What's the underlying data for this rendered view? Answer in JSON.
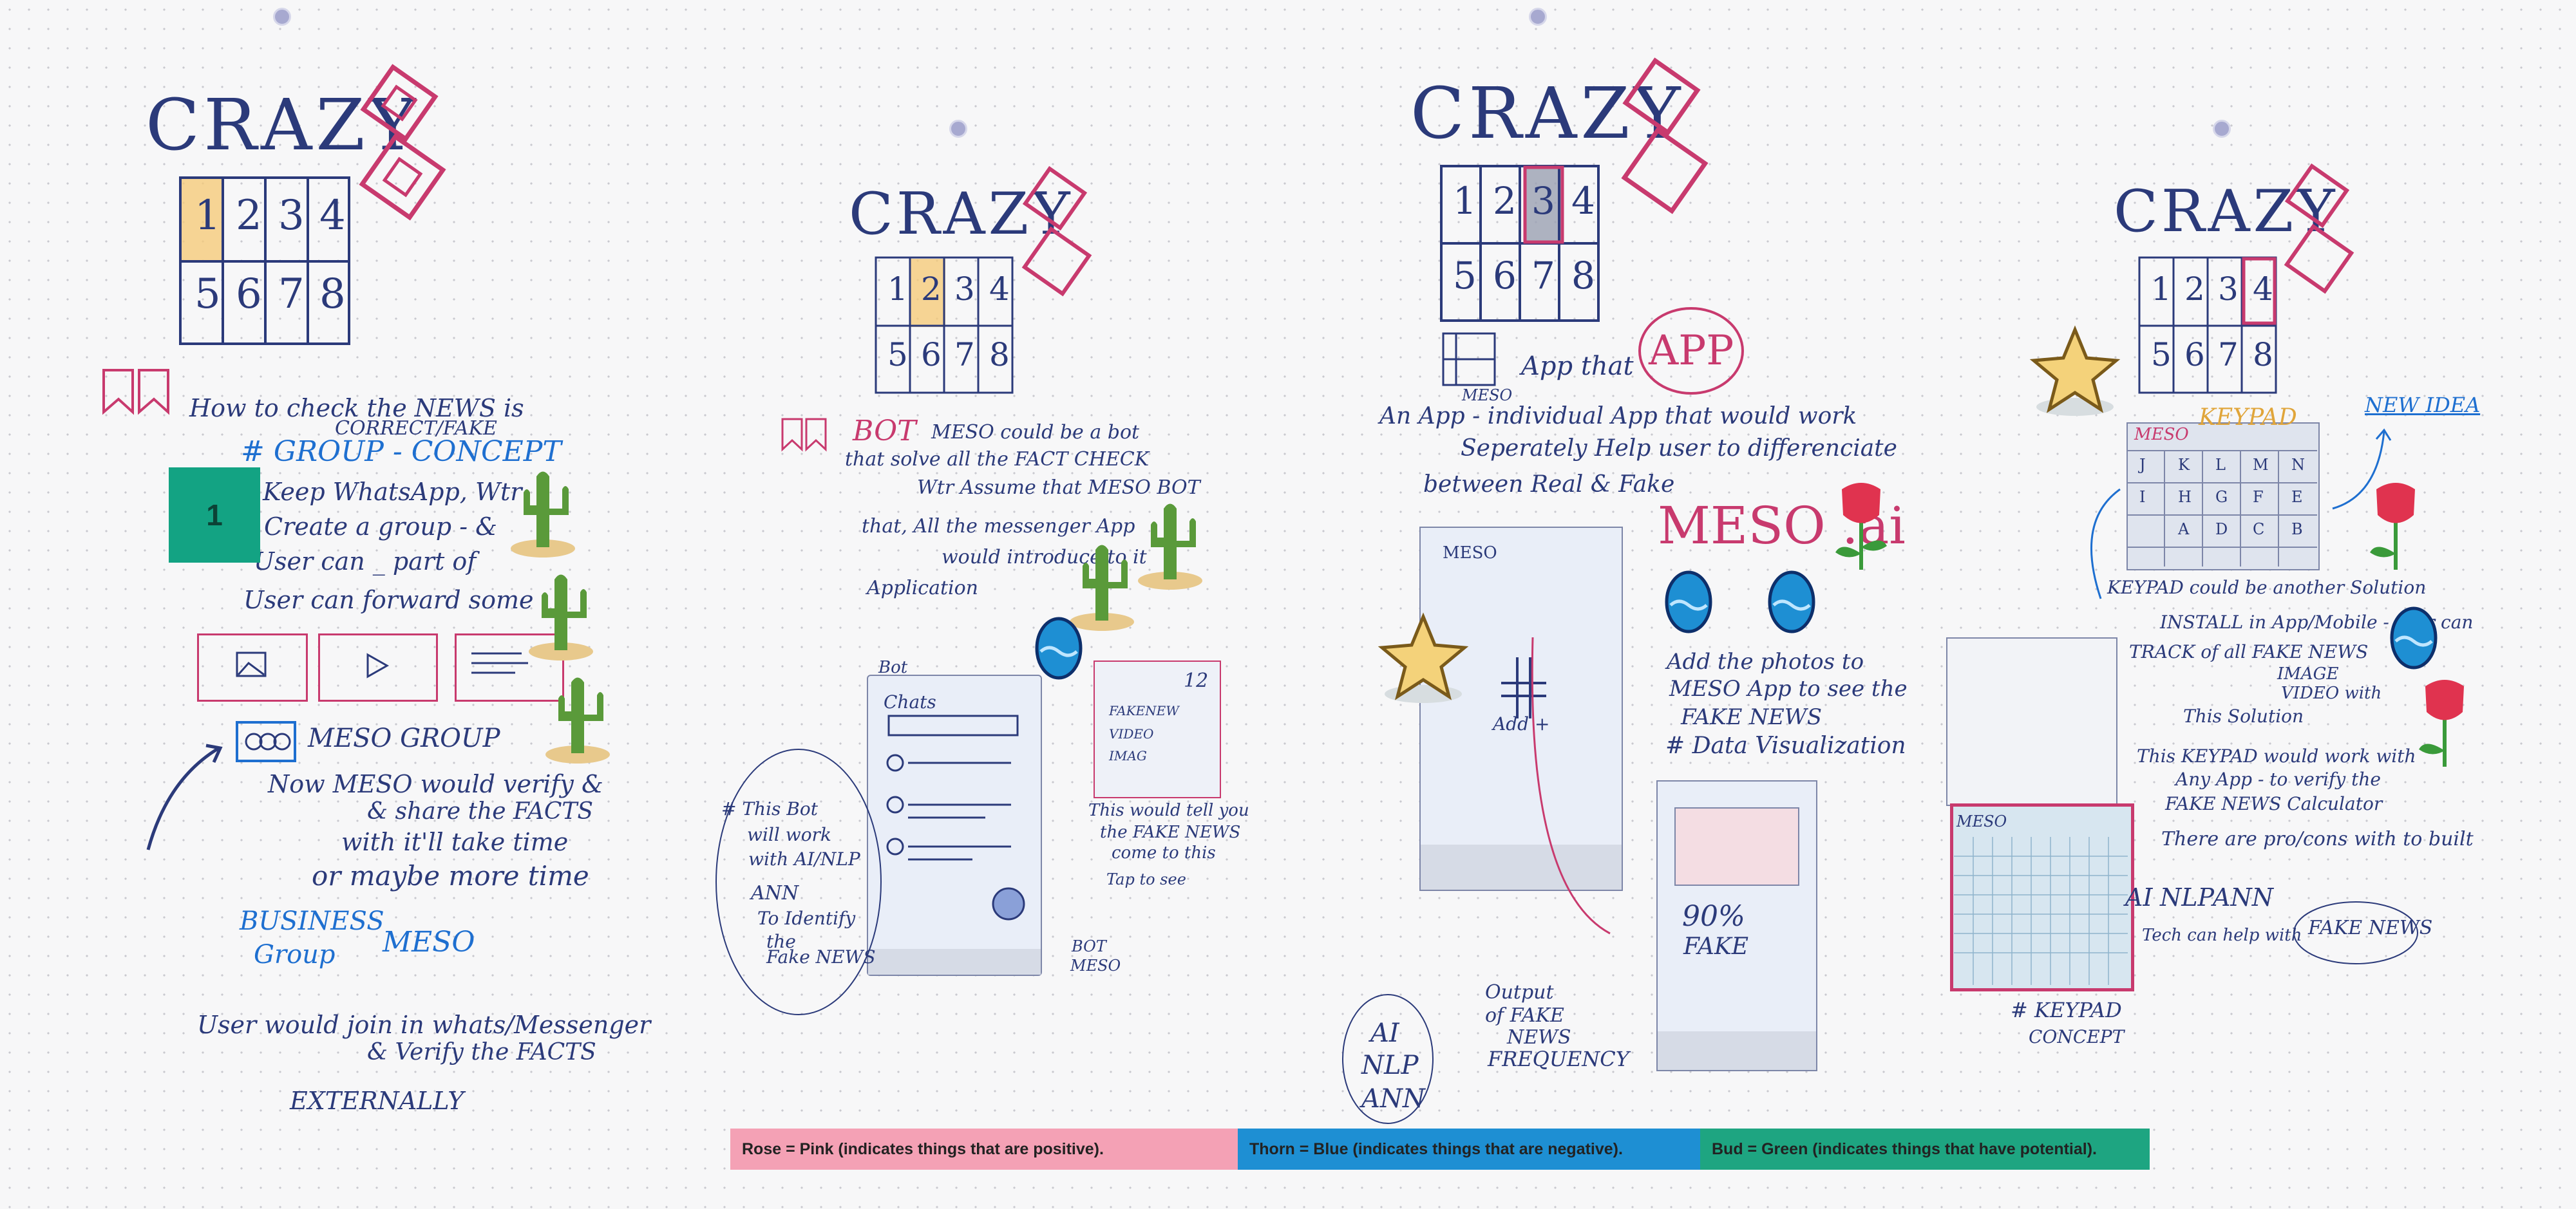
{
  "legend": {
    "rose": "Rose = Pink (indicates things that are positive).",
    "thorn": "Thorn = Blue (indicates things that are negative).",
    "bud": "Bud = Green (indicates things that have potential)."
  },
  "badge": {
    "label": "1"
  },
  "colors": {
    "ink": "#2b3a7a",
    "pink": "#c83a6e",
    "rose": "#f4a1b5",
    "thorn": "#1e8fd3",
    "bud": "#1ea581",
    "grid_highlight": "#f6c873"
  },
  "crazy8": {
    "title": "CRAZY",
    "row1": [
      "1",
      "2",
      "3",
      "4"
    ],
    "row2": [
      "5",
      "6",
      "7",
      "8"
    ]
  },
  "panel1": {
    "lines": [
      "How to check the NEWS is",
      "CORRECT/FAKE",
      "# GROUP - CONCEPT",
      "Keep WhatsApp, Wtr",
      "Create a group - &",
      "User can _ part of",
      "User can forward some",
      "MESO GROUP",
      "Now MESO would verify &",
      "& share the FACTS",
      "with it'll take time",
      "or maybe more time",
      "BUSINESS",
      "Group",
      "MESO",
      "User would join in whats/Messenger",
      "& Verify the FACTS",
      "EXTERNALLY"
    ]
  },
  "panel2": {
    "title": "BOT",
    "lines": [
      "MESO could be a bot",
      "that solve all the FACT CHECK",
      "Wtr Assume that MESO BOT",
      "that, All the messenger App",
      "would introduce to it",
      "Application",
      "Bot",
      "Chats",
      "12",
      "FAKENEW",
      "VIDEO",
      "IMAG",
      "This would tell you",
      "the FAKE NEWS",
      "come to this",
      "Tap to see",
      "BOT",
      "MESO",
      "# This Bot",
      "will work",
      "with AI/NLP",
      "ANN",
      "To Identify",
      "the",
      "Fake NEWS"
    ]
  },
  "panel3": {
    "lines": [
      "MESO",
      "App that",
      "APP",
      "An App - individual App that would work",
      "Seperately Help user to differenciate",
      "between Real & Fake",
      "MESO",
      "MESO .ai",
      "Add +",
      "Add the photos to",
      "MESO App to see the",
      "FAKE NEWS",
      "# Data Visualization",
      "90%",
      "FAKE",
      "Output",
      "of FAKE",
      "NEWS",
      "FREQUENCY",
      "AI",
      "NLP",
      "ANN"
    ]
  },
  "panel4": {
    "lines": [
      "MESO",
      "KEYPAD",
      "NEW IDEA",
      "KEYPAD could be another Solution",
      "INSTALL in App/Mobile - user can",
      "TRACK of all FAKE NEWS",
      "IMAGE",
      "VIDEO with",
      "This Solution",
      "This KEYPAD would work with",
      "Any App - to verify the",
      "FAKE NEWS Calculator",
      "There are pro/cons with to built",
      "AI",
      "NLP",
      "ANN",
      "Tech can help with",
      "FAKE NEWS",
      "MESO",
      "# KEYPAD",
      "CONCEPT"
    ],
    "keys": [
      "J",
      "K",
      "L",
      "M",
      "N",
      "I",
      "H",
      "G",
      "F",
      "E",
      "A",
      "D",
      "C",
      "B"
    ]
  },
  "icons": [
    "cactus-icon",
    "egg-icon",
    "rose-icon",
    "star-icon",
    "pin-icon"
  ]
}
